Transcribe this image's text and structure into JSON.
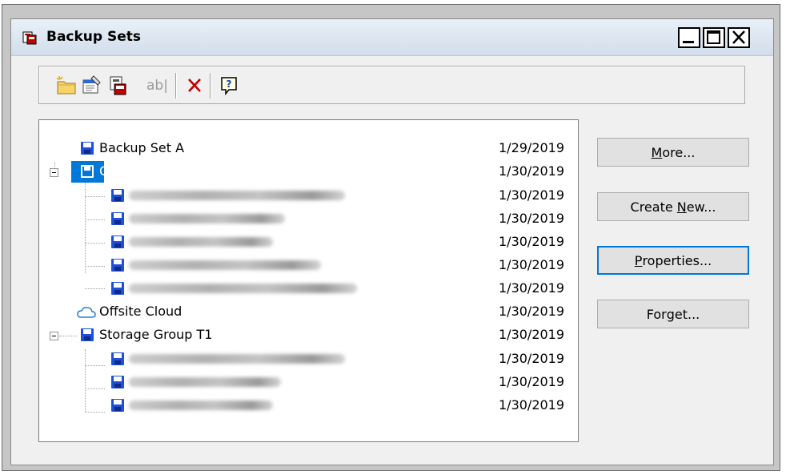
{
  "window": {
    "title": "Backup Sets",
    "accent": "#0078d7"
  },
  "toolbar": {
    "rename_text": "ab|",
    "tools": [
      "new-folder-icon",
      "properties-icon",
      "backup-icon",
      "rename-icon",
      "delete-icon",
      "help-icon"
    ]
  },
  "tree": {
    "rows": [
      {
        "label": "Backup Set A",
        "date": "1/29/2019"
      },
      {
        "label": "Client Storage Group",
        "date": "1/30/2019"
      },
      {
        "label": "",
        "date": "1/30/2019"
      },
      {
        "label": "",
        "date": "1/30/2019"
      },
      {
        "label": "",
        "date": "1/30/2019"
      },
      {
        "label": "",
        "date": "1/30/2019"
      },
      {
        "label": "",
        "date": "1/30/2019"
      },
      {
        "label": "Offsite Cloud",
        "date": "1/30/2019"
      },
      {
        "label": "Storage Group T1",
        "date": "1/30/2019"
      },
      {
        "label": "",
        "date": "1/30/2019"
      },
      {
        "label": "",
        "date": "1/30/2019"
      },
      {
        "label": "",
        "date": "1/30/2019"
      }
    ]
  },
  "buttons": {
    "more": {
      "pre": "",
      "key": "M",
      "post": "ore..."
    },
    "create_new": {
      "pre": "Create ",
      "key": "N",
      "post": "ew..."
    },
    "properties": {
      "pre": "",
      "key": "P",
      "post": "roperties..."
    },
    "forget": {
      "pre": "For",
      "key": "g",
      "post": "et..."
    }
  }
}
